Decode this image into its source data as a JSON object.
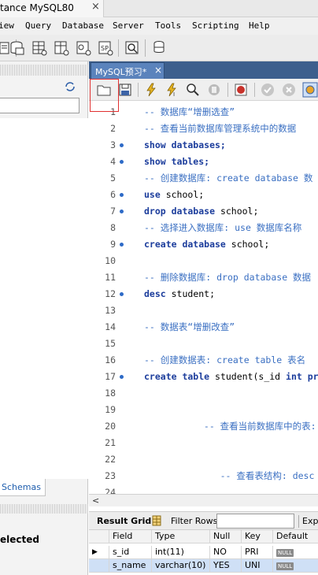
{
  "window": {
    "title": "tance MySQL80",
    "close_glyph": "×"
  },
  "menu": [
    "iew",
    "Query",
    "Database",
    "Server",
    "Tools",
    "Scripting",
    "Help"
  ],
  "toolbar_icons": [
    "new-sql-tab-icon",
    "open-sql-script-icon",
    "create-schema-icon",
    "create-table-icon",
    "create-view-icon",
    "create-procedure-icon",
    "create-function-icon",
    "search-table-data-icon",
    "reconnect-icon"
  ],
  "editor_tab": {
    "label": "MySQL预习*",
    "close_glyph": "×"
  },
  "editor_toolbar_icons": [
    "open-file-icon",
    "save-icon",
    "execute-icon",
    "execute-current-icon",
    "explain-icon",
    "stop-icon",
    "toggle-error-icon",
    "commit-icon",
    "rollback-icon",
    "auto-commit-icon"
  ],
  "code_lines": [
    {
      "n": "1",
      "dot": false,
      "text": "-- 数据库“增删选查”",
      "kind": "comment"
    },
    {
      "n": "2",
      "dot": false,
      "text": "-- 查看当前数据库管理系统中的数据",
      "kind": "comment"
    },
    {
      "n": "3",
      "dot": true,
      "text": "show databases;",
      "kind": "kw"
    },
    {
      "n": "4",
      "dot": true,
      "text": "show tables;",
      "kind": "kw"
    },
    {
      "n": "5",
      "dot": false,
      "text": "-- 创建数据库: create database 数",
      "kind": "comment"
    },
    {
      "n": "6",
      "dot": true,
      "kw": "use",
      "rest": " school;",
      "kind": "mixed"
    },
    {
      "n": "7",
      "dot": true,
      "kw": "drop database",
      "rest": " school;",
      "kind": "mixed"
    },
    {
      "n": "8",
      "dot": false,
      "text": "-- 选择进入数据库: use 数据库名称",
      "kind": "comment"
    },
    {
      "n": "9",
      "dot": true,
      "kw": "create database",
      "rest": " school;",
      "kind": "mixed"
    },
    {
      "n": "10",
      "dot": false,
      "text": "",
      "kind": "blank"
    },
    {
      "n": "11",
      "dot": false,
      "text": "-- 删除数据库: drop database 数据",
      "kind": "comment"
    },
    {
      "n": "12",
      "dot": true,
      "kw": "desc",
      "rest": " student;",
      "kind": "mixed"
    },
    {
      "n": "13",
      "dot": false,
      "text": "",
      "kind": "blank"
    },
    {
      "n": "14",
      "dot": false,
      "text": "-- 数据表“增删改查”",
      "kind": "comment"
    },
    {
      "n": "15",
      "dot": false,
      "text": "",
      "kind": "blank"
    },
    {
      "n": "16",
      "dot": false,
      "text": "-- 创建数据表: create table 表名",
      "kind": "comment"
    },
    {
      "n": "17",
      "dot": true,
      "kw": "create table",
      "rest": " student(s_id ",
      "kw2": "int pr",
      "kind": "mixed"
    },
    {
      "n": "18",
      "dot": false,
      "text": "",
      "kind": "blank"
    },
    {
      "n": "19",
      "dot": false,
      "text": "",
      "kind": "blank"
    },
    {
      "n": "20",
      "dot": false,
      "text": "-- 查看当前数据库中的表:  show t",
      "kind": "comment",
      "offset": 11
    },
    {
      "n": "21",
      "dot": false,
      "text": "",
      "kind": "blank"
    },
    {
      "n": "22",
      "dot": false,
      "text": "",
      "kind": "blank"
    },
    {
      "n": "23",
      "dot": false,
      "text": "-- 查看表结构: desc 表名;",
      "kind": "comment",
      "offset": 14
    },
    {
      "n": "24",
      "dot": false,
      "text": "",
      "kind": "blank"
    }
  ],
  "left_panel": {
    "schemas_tab": "Schemas",
    "info_text": "elected"
  },
  "result_bar": {
    "grid_label": "Result Grid",
    "filter_label": "Filter Rows:",
    "export_label": "Expo"
  },
  "result_grid": {
    "columns": [
      "",
      "Field",
      "Type",
      "Null",
      "Key",
      "Default"
    ],
    "rows": [
      {
        "field": "s_id",
        "type": "int(11)",
        "null": "NO",
        "key": "PRI",
        "default": "NULL"
      },
      {
        "field": "s_name",
        "type": "varchar(10)",
        "null": "YES",
        "key": "UNI",
        "default": "NULL"
      }
    ],
    "row_arrow": "▶"
  },
  "colors": {
    "comment": "#3a6fc2",
    "keyword": "#1c3d9c",
    "tab_active": "#5b83bc",
    "tabbar": "#3d5f8d",
    "highlight_box": "#e03030"
  }
}
